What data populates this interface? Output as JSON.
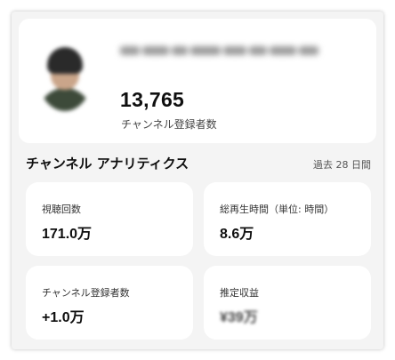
{
  "channel": {
    "name_hidden": true,
    "subscriber_count": "13,765",
    "subscriber_label": "チャンネル登録者数"
  },
  "analytics": {
    "title": "チャンネル アナリティクス",
    "period": "過去 28 日間",
    "metrics": [
      {
        "label": "視聴回数",
        "value": "171.0万"
      },
      {
        "label": "総再生時間（単位: 時間）",
        "value": "8.6万"
      },
      {
        "label": "チャンネル登録者数",
        "value": "+1.0万"
      },
      {
        "label": "推定収益",
        "value": "¥39万"
      }
    ]
  }
}
